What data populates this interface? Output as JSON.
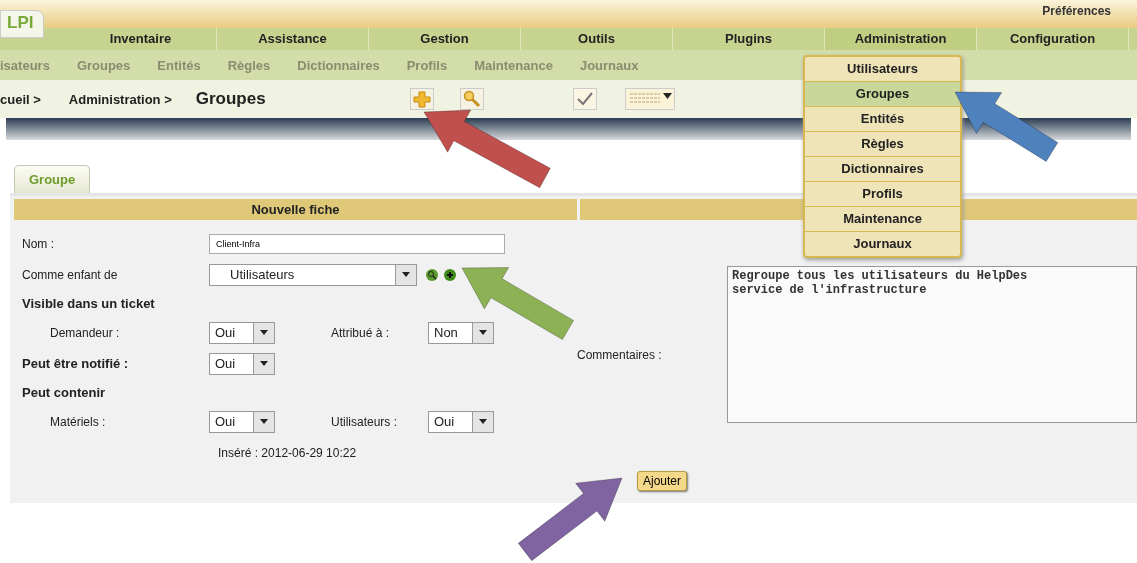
{
  "header": {
    "logo": "LPI",
    "preferences": "Préférences"
  },
  "main_menu": [
    {
      "label": "Inventaire",
      "selected": false
    },
    {
      "label": "Assistance",
      "selected": false
    },
    {
      "label": "Gestion",
      "selected": false
    },
    {
      "label": "Outils",
      "selected": false
    },
    {
      "label": "Plugins",
      "selected": false
    },
    {
      "label": "Administration",
      "selected": true
    },
    {
      "label": "Configuration",
      "selected": false
    }
  ],
  "sub_menu": [
    "isateurs",
    "Groupes",
    "Entités",
    "Règles",
    "Dictionnaires",
    "Profils",
    "Maintenance",
    "Journaux"
  ],
  "breadcrumb": [
    "cueil >",
    "Administration >"
  ],
  "page_title": "Groupes",
  "tab": {
    "label": "Groupe",
    "selected": true
  },
  "form": {
    "header": "Nouvelle fiche",
    "name": {
      "label": "Nom :",
      "value": "Client-Infra"
    },
    "parent": {
      "label": "Comme enfant de",
      "value": "Utilisateurs"
    },
    "visible_heading": "Visible dans un ticket",
    "requester": {
      "label": "Demandeur :",
      "value": "Oui"
    },
    "assigned": {
      "label": "Attribué à :",
      "value": "Non"
    },
    "notify": {
      "label": "Peut être notifié :",
      "value": "Oui"
    },
    "contain_heading": "Peut contenir",
    "items": {
      "label": "Matériels :",
      "value": "Oui"
    },
    "users": {
      "label": "Utilisateurs :",
      "value": "Oui"
    },
    "inserted": "Inséré : 2012-06-29 10:22",
    "comments": {
      "label": "Commentaires :",
      "value": "Regroupe tous les utilisateurs du HelpDes\nservice de l'infrastructure"
    },
    "submit": "Ajouter"
  },
  "dropdown": [
    {
      "label": "Utilisateurs",
      "selected": false
    },
    {
      "label": "Groupes",
      "selected": true
    },
    {
      "label": "Entités",
      "selected": false
    },
    {
      "label": "Règles",
      "selected": false
    },
    {
      "label": "Dictionnaires",
      "selected": false
    },
    {
      "label": "Profils",
      "selected": false
    },
    {
      "label": "Maintenance",
      "selected": false
    },
    {
      "label": "Journaux",
      "selected": false
    }
  ],
  "annotation_arrows": [
    {
      "color": "#c0504d"
    },
    {
      "color": "#4f81bd"
    },
    {
      "color": "#8db255"
    },
    {
      "color": "#8064a2"
    }
  ]
}
